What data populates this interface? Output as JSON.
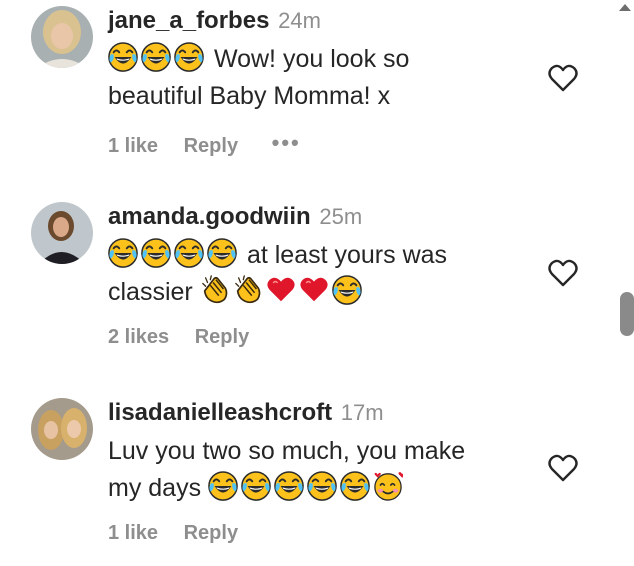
{
  "comments": [
    {
      "username": "jane_a_forbes",
      "time": "24m",
      "text_line1": "Wow! you look so",
      "text_line2": "beautiful Baby Momma! x",
      "likes": "1 like",
      "reply": "Reply",
      "more": "•••"
    },
    {
      "username": "amanda.goodwiin",
      "time": "25m",
      "text_line1": "at least yours was",
      "text_line2": "classier",
      "likes": "2 likes",
      "reply": "Reply"
    },
    {
      "username": "lisadanielleashcroft",
      "time": "17m",
      "text_line1": "Luv you two so much, you make",
      "text_line2": "my days",
      "likes": "1 like",
      "reply": "Reply"
    }
  ],
  "icons": {
    "like": "heart-outline-icon",
    "joy": "face-with-tears-of-joy-icon",
    "clap": "clapping-hands-icon",
    "heart": "red-heart-icon",
    "hearts_face": "smiling-face-with-hearts-icon",
    "more": "more-options-icon"
  },
  "colors": {
    "text": "#262626",
    "muted": "#8e8e8e",
    "heart_red": "#e0162b",
    "emoji_yellow": "#fcc21b"
  }
}
